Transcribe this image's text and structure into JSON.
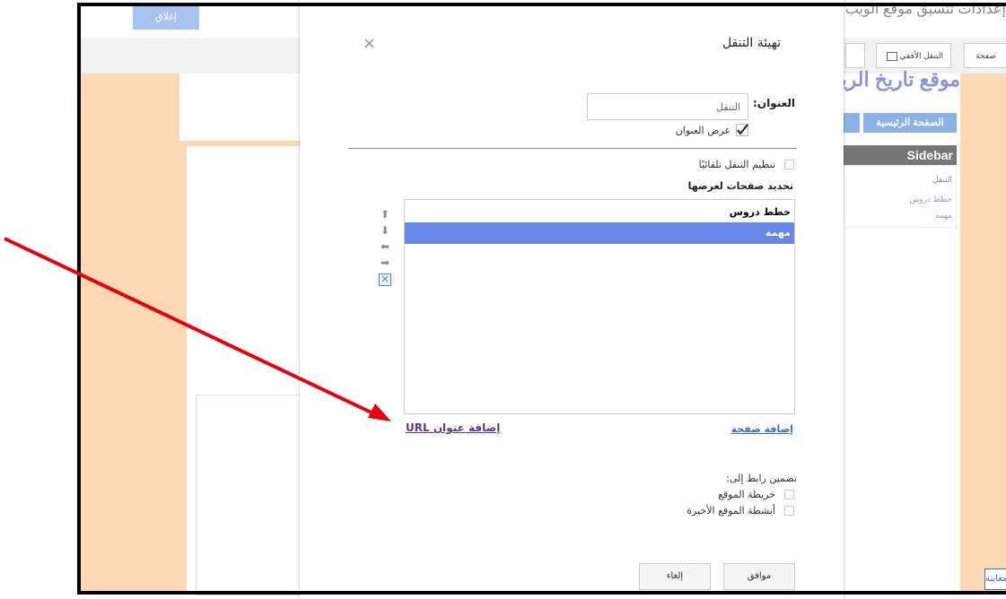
{
  "background": {
    "close_button_label": "إغلاق",
    "right_title": "إعدادات تنسيق موقع الويب",
    "toolbar": {
      "horizontal_nav_label": "التنقل الأفقي",
      "page_label": "صفحة"
    },
    "site_title": "موقع تاريخ الرياضيات",
    "home_tab_label": "الصفحة الرئيسية",
    "sidebar": {
      "heading": "Sidebar",
      "items": [
        "التنقل",
        "خطط دروس",
        "مهمة"
      ]
    },
    "preview_label": "معاينة"
  },
  "dialog": {
    "title": "تهيئة التنقل",
    "title_field_label": "العنوان:",
    "title_field_value": "التنقل",
    "show_title_label": "عرض العنوان",
    "auto_organize_label": "تنظيم التنقل تلقائيًا",
    "select_pages_label": "تحديد صفحات لعرضها",
    "pages": [
      {
        "label": "خطط دروس",
        "selected": false
      },
      {
        "label": "مهمة",
        "selected": true
      }
    ],
    "add_page_link": "إضافة صفحة",
    "add_url_link": "إضافة عنوان URL",
    "include_link_label": "تضمين رابط إلى:",
    "sitemap_label": "خريطة الموقع",
    "recent_activity_label": "أنشطة الموقع الأخيرة",
    "ok_label": "موافق",
    "cancel_label": "إلغاء",
    "close_icon": "×"
  },
  "colors": {
    "peach": "#fdd8b4",
    "selection": "#6788e6",
    "annotation_arrow": "#e8000b",
    "link": "#3f6bc2"
  }
}
